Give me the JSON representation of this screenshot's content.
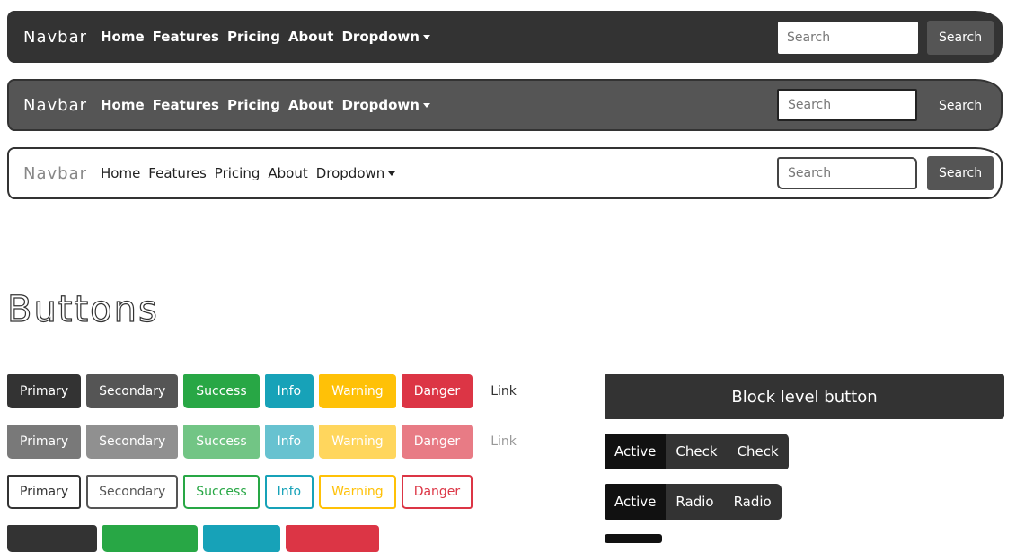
{
  "navbars": [
    {
      "brand": "Navbar",
      "items": [
        "Home",
        "Features",
        "Pricing",
        "About",
        "Dropdown"
      ],
      "search_placeholder": "Search",
      "search_button": "Search"
    },
    {
      "brand": "Navbar",
      "items": [
        "Home",
        "Features",
        "Pricing",
        "About",
        "Dropdown"
      ],
      "search_placeholder": "Search",
      "search_button": "Search"
    },
    {
      "brand": "Navbar",
      "items": [
        "Home",
        "Features",
        "Pricing",
        "About",
        "Dropdown"
      ],
      "search_placeholder": "Search",
      "search_button": "Search"
    }
  ],
  "buttons_section": {
    "title": "Buttons",
    "solid_row": [
      "Primary",
      "Secondary",
      "Success",
      "Info",
      "Warning",
      "Danger",
      "Link"
    ],
    "disabled_row": [
      "Primary",
      "Secondary",
      "Success",
      "Info",
      "Warning",
      "Danger",
      "Link"
    ],
    "outline_row": [
      "Primary",
      "Secondary",
      "Success",
      "Info",
      "Warning",
      "Danger"
    ],
    "block_button": "Block level button",
    "check_group": [
      "Active",
      "Check",
      "Check"
    ],
    "radio_group": [
      "Active",
      "Radio",
      "Radio"
    ]
  },
  "colors": {
    "primary": "#333333",
    "secondary": "#555555",
    "success": "#28a745",
    "info": "#17a2b8",
    "warning": "#ffc107",
    "danger": "#dc3545"
  }
}
